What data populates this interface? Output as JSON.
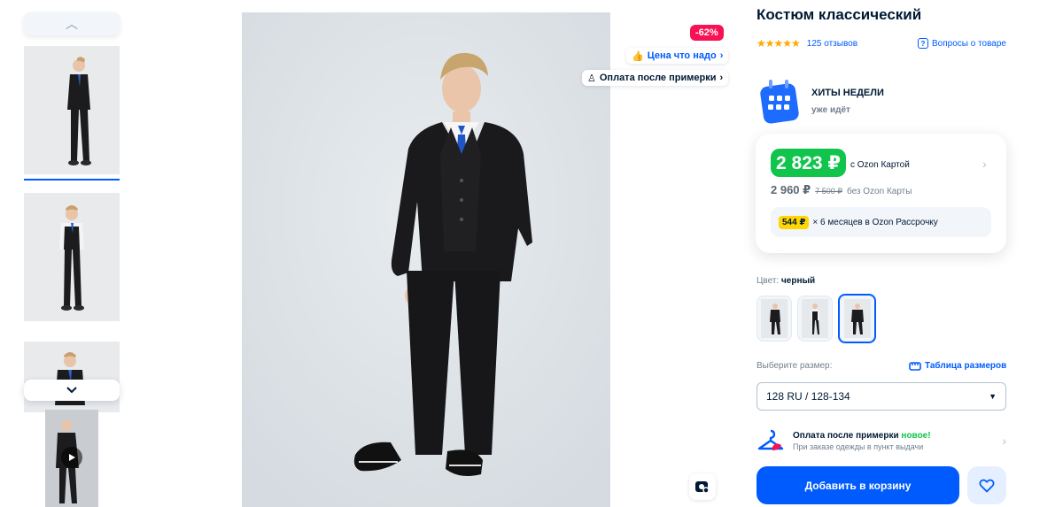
{
  "thumbnails": [
    {
      "alt": "Мальчик в костюме, вид спереди"
    },
    {
      "alt": "Мальчик в жилете"
    },
    {
      "alt": "Мальчик в костюме, крупный план"
    },
    {
      "alt": "Видео"
    }
  ],
  "badges": {
    "discount": "-62%",
    "price_ok": "Цена что надо",
    "pay_after_fitting": "Оплата после примерки"
  },
  "product": {
    "title": "Костюм классический",
    "stars": "★★★★★",
    "reviews": "125 отзывов",
    "questions": "Вопросы о товаре"
  },
  "promo": {
    "title": "ХИТЫ НЕДЕЛИ",
    "subtitle": "уже идёт"
  },
  "price": {
    "card_price": "2 823 ₽",
    "card_label": "с Ozon Картой",
    "regular_price": "2 960 ₽",
    "old_price": "7 500 ₽",
    "regular_label": "без Ozon Карты",
    "installment_amount": "544 ₽",
    "installment_text": "× 6 месяцев в Ozon Рассрочку"
  },
  "color": {
    "label": "Цвет:",
    "value": "черный"
  },
  "size": {
    "label": "Выберите размер:",
    "table_link": "Таблица размеров",
    "selected": "128 RU / 128-134"
  },
  "pay_after": {
    "title": "Оплата после примерки",
    "new_tag": "новое!",
    "subtitle": "При заказе одежды в пункт выдачи"
  },
  "actions": {
    "add_to_cart": "Добавить в корзину"
  },
  "colors": {
    "accent": "#005bff",
    "green": "#10c44c",
    "discount": "#f91155",
    "installment": "#ffd600"
  }
}
